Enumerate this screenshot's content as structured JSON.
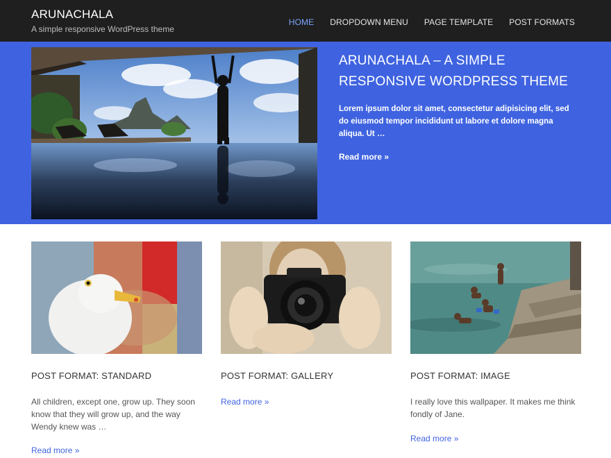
{
  "site": {
    "title": "ARUNACHALA",
    "description": "A simple responsive WordPress theme"
  },
  "nav": {
    "items": [
      {
        "label": "HOME",
        "active": true
      },
      {
        "label": "DROPDOWN MENU",
        "active": false
      },
      {
        "label": "PAGE TEMPLATE",
        "active": false
      },
      {
        "label": "POST FORMATS",
        "active": false
      }
    ]
  },
  "hero": {
    "title": "ARUNACHALA – A SIMPLE RESPONSIVE WORDPRESS THEME",
    "excerpt": "Lorem ipsum dolor sit amet, consectetur adipisicing elit, sed do eiusmod tempor incididunt ut labore et dolore magna aliqua. Ut …",
    "read_more": "Read more »",
    "background_color": "#3f63e0"
  },
  "posts": [
    {
      "title": "POST FORMAT: STANDARD",
      "excerpt": "All children, except one, grow up. They soon know that they will grow up, and the way Wendy knew was …",
      "read_more": "Read more »"
    },
    {
      "title": "POST FORMAT: GALLERY",
      "excerpt": "",
      "read_more": "Read more »"
    },
    {
      "title": "POST FORMAT: IMAGE",
      "excerpt": "I really love this wallpaper. It makes me think fondly of Jane.",
      "read_more": "Read more »"
    }
  ],
  "colors": {
    "header_bg": "#1f1f1f",
    "accent": "#3f63e0",
    "active_nav": "#7aa6ff"
  }
}
